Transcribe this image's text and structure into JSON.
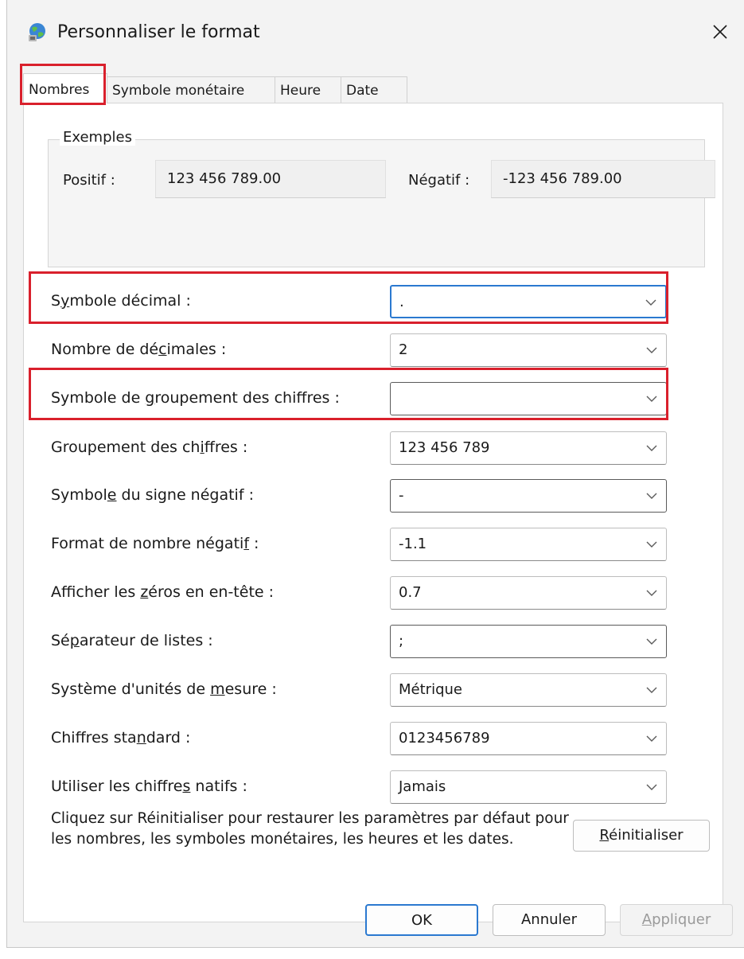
{
  "window": {
    "title": "Personnaliser le format",
    "close": "✕"
  },
  "tabs": [
    {
      "label": "Nombres",
      "active": true
    },
    {
      "label": "Symbole monétaire",
      "active": false
    },
    {
      "label": "Heure",
      "active": false
    },
    {
      "label": "Date",
      "active": false
    }
  ],
  "examples": {
    "title": "Exemples",
    "positive_label": "Positif :",
    "positive_value": "123 456 789.00",
    "negative_label": "Négatif :",
    "negative_value": "-123 456 789.00"
  },
  "rows": [
    {
      "label_pre": "S",
      "label_u": "y",
      "label_post": "mbole décimal :",
      "value": "."
    },
    {
      "label_pre": "Nombre de dé",
      "label_u": "c",
      "label_post": "imales :",
      "value": "2"
    },
    {
      "label_pre": "Symbole de ",
      "label_u": "g",
      "label_post": "roupement des chiffres :",
      "value": ""
    },
    {
      "label_pre": "Groupement des ch",
      "label_u": "i",
      "label_post": "ffres :",
      "value": "123 456 789"
    },
    {
      "label_pre": "Symbol",
      "label_u": "e",
      "label_post": " du signe négatif :",
      "value": "-"
    },
    {
      "label_pre": "Format de nombre négati",
      "label_u": "f",
      "label_post": " :",
      "value": "-1.1"
    },
    {
      "label_pre": "Afficher les ",
      "label_u": "z",
      "label_post": "éros en en-tête :",
      "value": "0.7"
    },
    {
      "label_pre": "Sé",
      "label_u": "p",
      "label_post": "arateur de listes :",
      "value": ";"
    },
    {
      "label_pre": "Système d'unités de ",
      "label_u": "m",
      "label_post": "esure :",
      "value": "Métrique"
    },
    {
      "label_pre": "Chiffres sta",
      "label_u": "n",
      "label_post": "dard :",
      "value": "0123456789"
    },
    {
      "label_pre": "Utiliser les chiffre",
      "label_u": "s",
      "label_post": " natifs :",
      "value": "Jamais"
    }
  ],
  "info_text": "Cliquez sur Réinitialiser pour restaurer les paramètres par défaut pour les nombres, les symboles monétaires, les heures et les dates.",
  "reset_button": {
    "pre": "",
    "u": "R",
    "post": "éinitialiser"
  },
  "footer": {
    "ok": "OK",
    "cancel": "Annuler",
    "apply_u": "A",
    "apply_post": "ppliquer"
  },
  "colors": {
    "highlight": "#d9202c",
    "focus": "#2b79d0"
  }
}
